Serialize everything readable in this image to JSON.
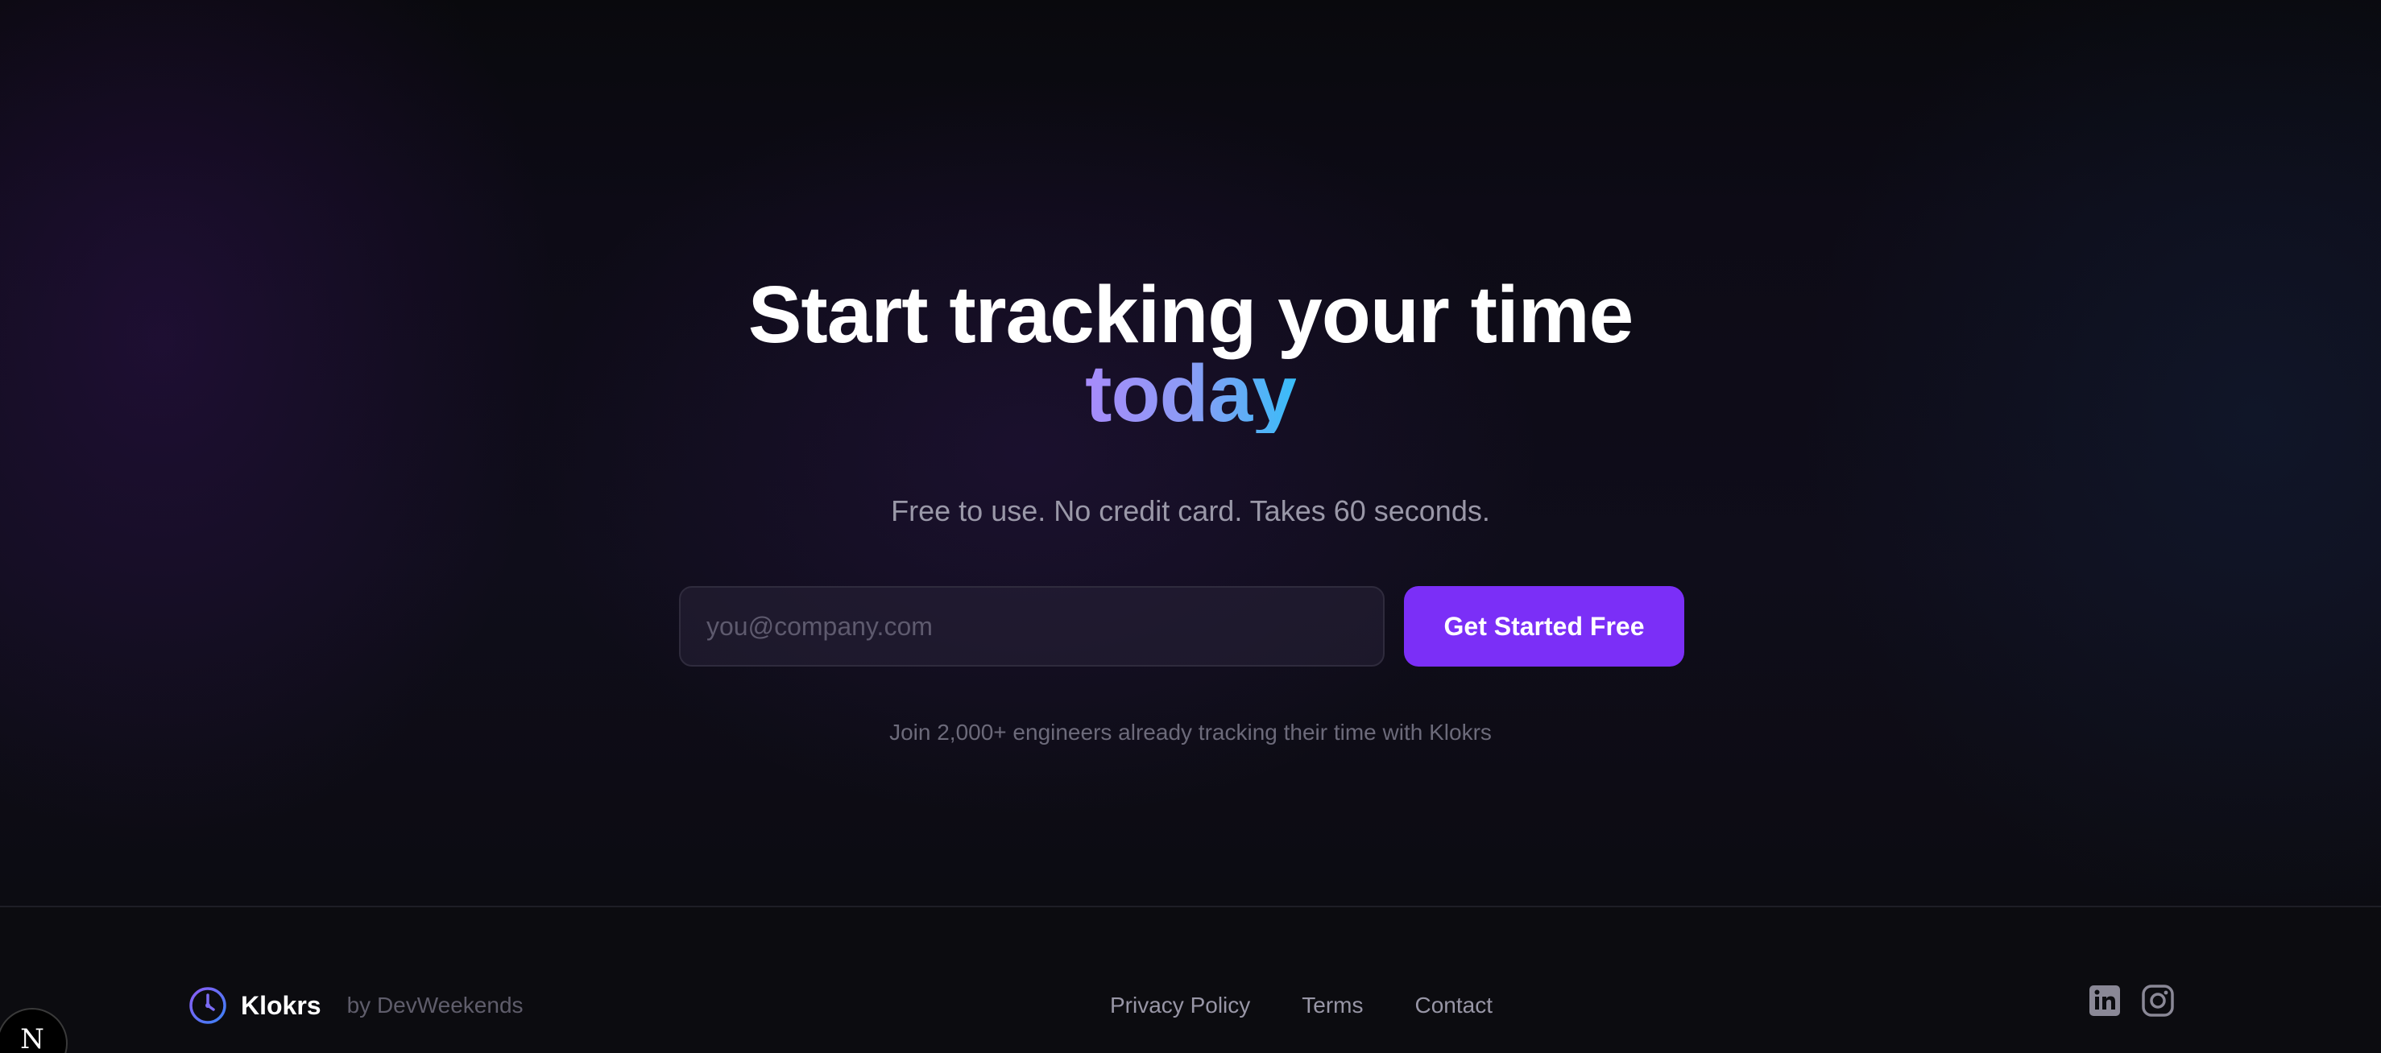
{
  "cta": {
    "headline_line1": "Start tracking your time",
    "headline_accent": "today",
    "subtitle": "Free to use. No credit card. Takes 60 seconds.",
    "email_placeholder": "you@company.com",
    "email_value": "",
    "button_label": "Get Started Free",
    "social_proof": "Join 2,000+ engineers already tracking their time with Klokrs",
    "accent_gradient": [
      "#a78bfa",
      "#38bdf8"
    ],
    "button_color": "#7b2ff7"
  },
  "footer": {
    "brand": {
      "name": "Klokrs",
      "by": "by DevWeekends",
      "icon": "clock-icon"
    },
    "links": [
      {
        "label": "Privacy Policy"
      },
      {
        "label": "Terms"
      },
      {
        "label": "Contact"
      }
    ],
    "socials": [
      {
        "icon": "linkedin-icon"
      },
      {
        "icon": "instagram-icon"
      }
    ]
  },
  "dev_indicator": {
    "label": "N"
  }
}
